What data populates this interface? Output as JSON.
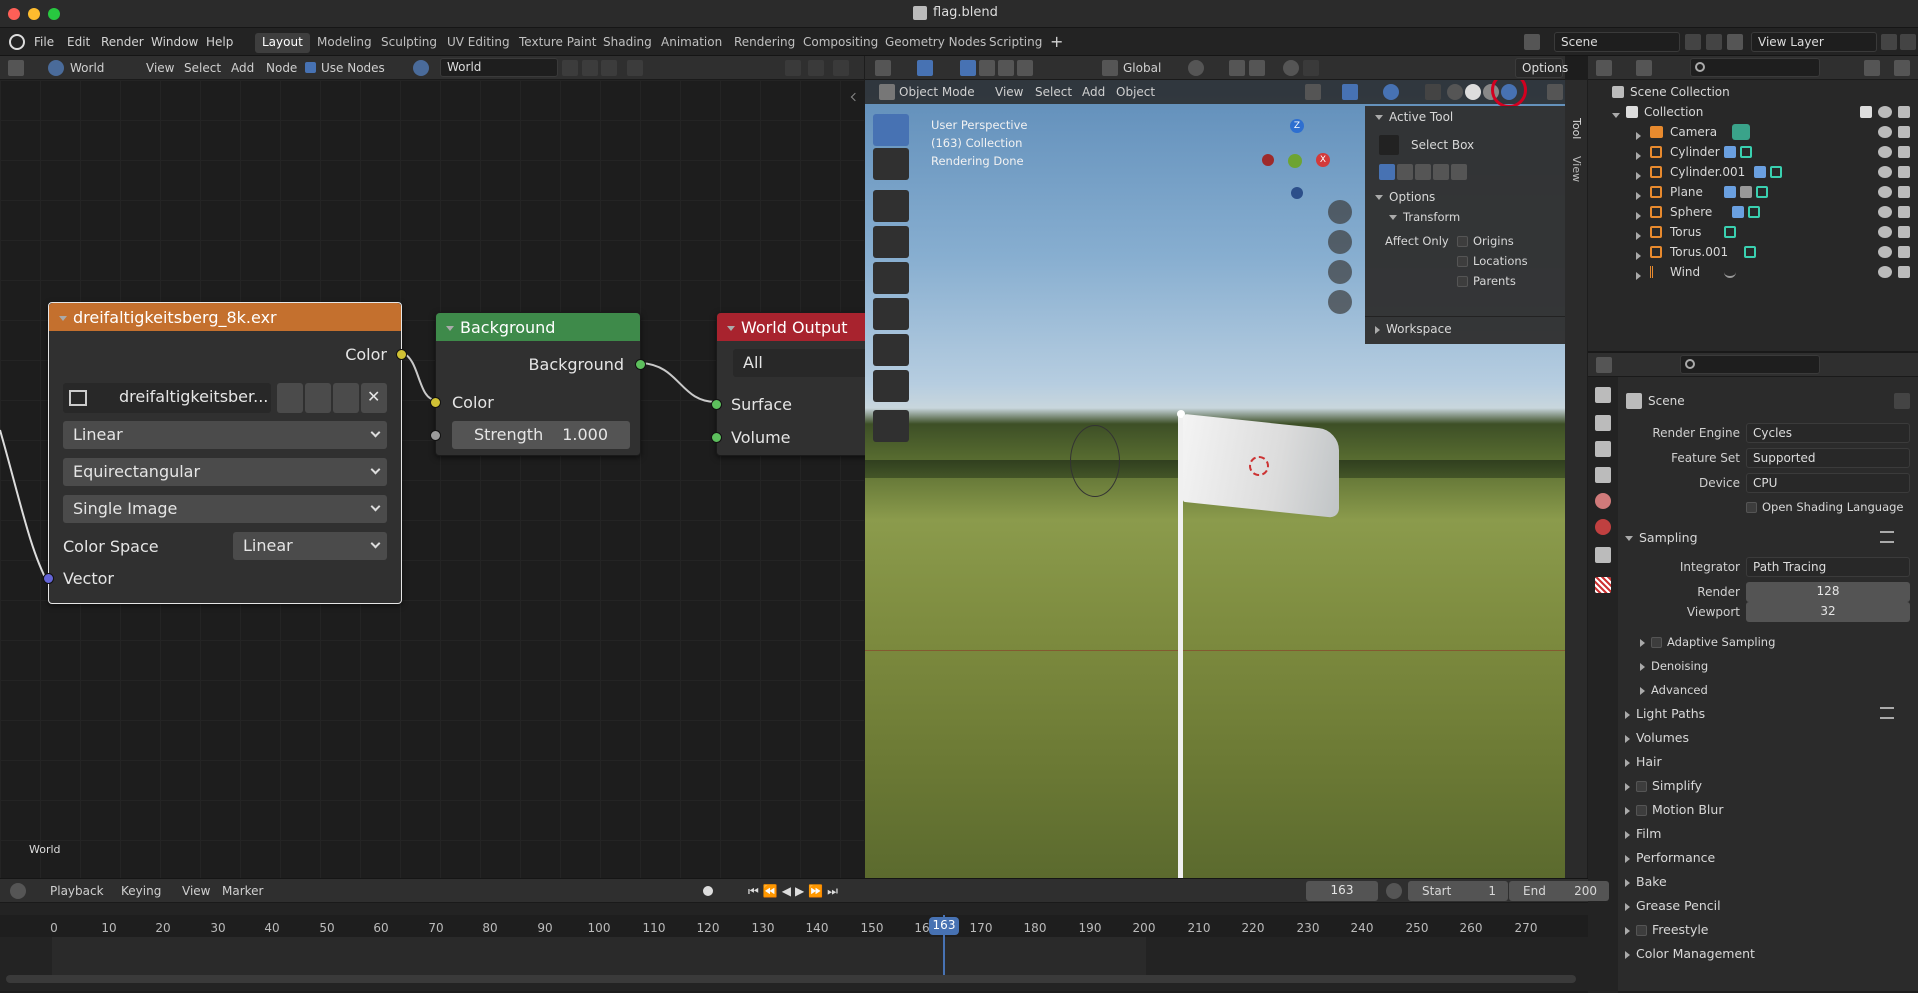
{
  "window": {
    "title": "flag.blend"
  },
  "menu": [
    "File",
    "Edit",
    "Render",
    "Window",
    "Help"
  ],
  "workspaces": [
    "Layout",
    "Modeling",
    "Sculpting",
    "UV Editing",
    "Texture Paint",
    "Shading",
    "Animation",
    "Rendering",
    "Compositing",
    "Geometry Nodes",
    "Scripting"
  ],
  "active_workspace": "Layout",
  "scene_field": "Scene",
  "view_layer_field": "View Layer",
  "node_header": {
    "type": "World",
    "menus": [
      "View",
      "Select",
      "Add",
      "Node"
    ],
    "use_nodes": "Use Nodes",
    "world_name": "World"
  },
  "node_editor_label": "World",
  "nodes": {
    "env": {
      "title": "dreifaltigkeitsberg_8k.exr",
      "color_out": "Color",
      "image_name": "dreifaltigkeitsber...",
      "interpolation": "Linear",
      "projection": "Equirectangular",
      "source": "Single Image",
      "color_space_label": "Color Space",
      "color_space": "Linear",
      "vector_in": "Vector"
    },
    "background": {
      "title": "Background",
      "out": "Background",
      "color_in": "Color",
      "strength_label": "Strength",
      "strength": "1.000"
    },
    "output": {
      "title": "World Output",
      "target": "All",
      "surface": "Surface",
      "volume": "Volume"
    }
  },
  "viewport": {
    "header": {
      "orientation": "Global",
      "options": "Options",
      "mode": "Object Mode",
      "menus": [
        "View",
        "Select",
        "Add",
        "Object"
      ]
    },
    "overlay_text": [
      "User Perspective",
      "(163) Collection",
      "Rendering Done"
    ],
    "gizmo": {
      "z": "Z",
      "x": "X"
    },
    "sidebar_tabs": [
      "Tool",
      "View"
    ],
    "n_panel": {
      "active_tool": "Active Tool",
      "tool": "Select Box",
      "options": "Options",
      "transform": "Transform",
      "affect_only": "Affect Only",
      "checks": [
        "Origins",
        "Locations",
        "Parents"
      ],
      "workspace": "Workspace"
    }
  },
  "outliner": {
    "root": "Scene Collection",
    "collection": "Collection",
    "items": [
      {
        "name": "Camera",
        "icon": "camera-icon"
      },
      {
        "name": "Cylinder",
        "icon": "mesh-icon"
      },
      {
        "name": "Cylinder.001",
        "icon": "mesh-icon"
      },
      {
        "name": "Plane",
        "icon": "mesh-icon"
      },
      {
        "name": "Sphere",
        "icon": "mesh-icon"
      },
      {
        "name": "Torus",
        "icon": "mesh-icon"
      },
      {
        "name": "Torus.001",
        "icon": "mesh-icon"
      },
      {
        "name": "Wind",
        "icon": "force-field-icon"
      }
    ]
  },
  "properties": {
    "context": "Scene",
    "render_engine_label": "Render Engine",
    "render_engine": "Cycles",
    "feature_set_label": "Feature Set",
    "feature_set": "Supported",
    "device_label": "Device",
    "device": "CPU",
    "osl": "Open Shading Language",
    "sampling": "Sampling",
    "integrator_label": "Integrator",
    "integrator": "Path Tracing",
    "render_label": "Render",
    "render_samples": "128",
    "viewport_label": "Viewport",
    "viewport_samples": "32",
    "sub": [
      "Adaptive Sampling",
      "Denoising",
      "Advanced"
    ],
    "sections": [
      "Light Paths",
      "Volumes",
      "Hair",
      "Simplify",
      "Motion Blur",
      "Film",
      "Performance",
      "Bake",
      "Grease Pencil",
      "Freestyle",
      "Color Management"
    ]
  },
  "timeline": {
    "menus": [
      "Playback",
      "Keying",
      "View",
      "Marker"
    ],
    "current_frame": "163",
    "start_label": "Start",
    "start": "1",
    "end_label": "End",
    "end": "200",
    "ticks": [
      "0",
      "10",
      "20",
      "30",
      "40",
      "50",
      "60",
      "70",
      "80",
      "90",
      "100",
      "110",
      "120",
      "130",
      "140",
      "150",
      "16",
      "170",
      "180",
      "190",
      "200",
      "210",
      "220",
      "230",
      "240",
      "250",
      "260",
      "270"
    ]
  },
  "colors": {
    "accent": "#4772b3",
    "env_node": "#c4702e",
    "bg_node": "#3e8a4a",
    "out_node": "#a8232e",
    "highlight_ring": "#d2001f"
  }
}
